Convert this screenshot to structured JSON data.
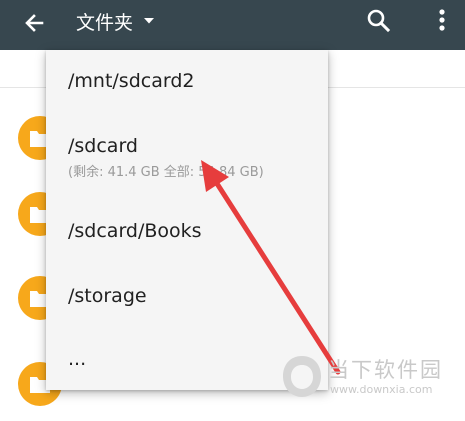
{
  "toolbar": {
    "title": "文件夹",
    "icons": {
      "back": "arrow-back-icon",
      "dropdown": "caret-down-icon",
      "search": "search-icon",
      "more": "more-vert-icon"
    }
  },
  "colors": {
    "toolbar_bg": "#37474f",
    "folder_accent": "#f7a81b",
    "menu_bg": "#f5f5f5",
    "annotation_arrow": "#e63d3d"
  },
  "menu": {
    "items": [
      {
        "path": "/mnt/sdcard2"
      },
      {
        "path": "/sdcard",
        "info": "(剩余: 41.4 GB 全部: 54.84 GB)"
      },
      {
        "path": "/sdcard/Books"
      },
      {
        "path": "/storage"
      },
      {
        "path": "..."
      }
    ]
  },
  "watermark": {
    "name": "当下软件园",
    "url": "www.downxia.com"
  }
}
